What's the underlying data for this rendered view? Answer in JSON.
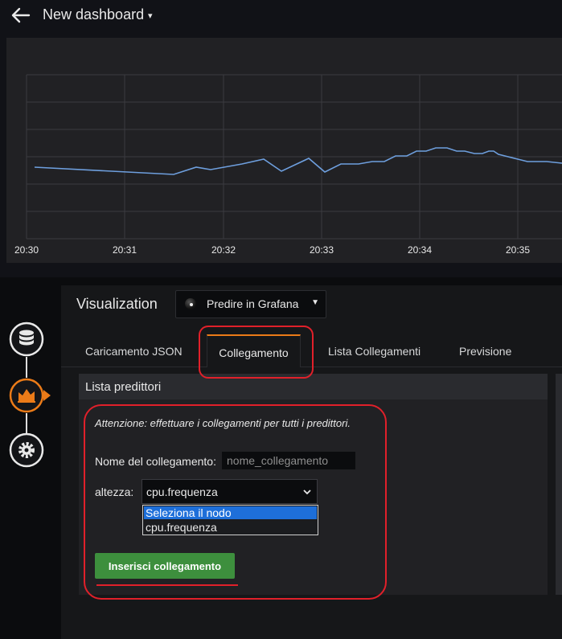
{
  "header": {
    "title": "New dashboard"
  },
  "graph": {
    "x_ticks": [
      "20:30",
      "20:31",
      "20:32",
      "20:33",
      "20:34",
      "20:35"
    ],
    "line_color": "#6e9fde"
  },
  "visualization": {
    "label": "Visualization",
    "plugin_name": "Predire in Grafana"
  },
  "tabs": [
    {
      "label": "Caricamento JSON"
    },
    {
      "label": "Collegamento",
      "active": true
    },
    {
      "label": "Lista Collegamenti"
    },
    {
      "label": "Previsione"
    }
  ],
  "panel": {
    "title": "Lista predittori",
    "warning": "Attenzione: effettuare i collegamenti per tutti i predittori.",
    "name_label": "Nome del collegamento:",
    "name_placeholder": "nome_collegamento",
    "height_label": "altezza:",
    "height_value": "cpu.frequenza",
    "dropdown_options": [
      "Seleziona il nodo",
      "cpu.frequenza"
    ],
    "insert_button": "Inserisci collegamento"
  },
  "colors": {
    "accent": "#eb7b18",
    "annotation": "#e1202a",
    "button_green": "#3d8f3d",
    "selected_option": "#1e6fd9"
  }
}
